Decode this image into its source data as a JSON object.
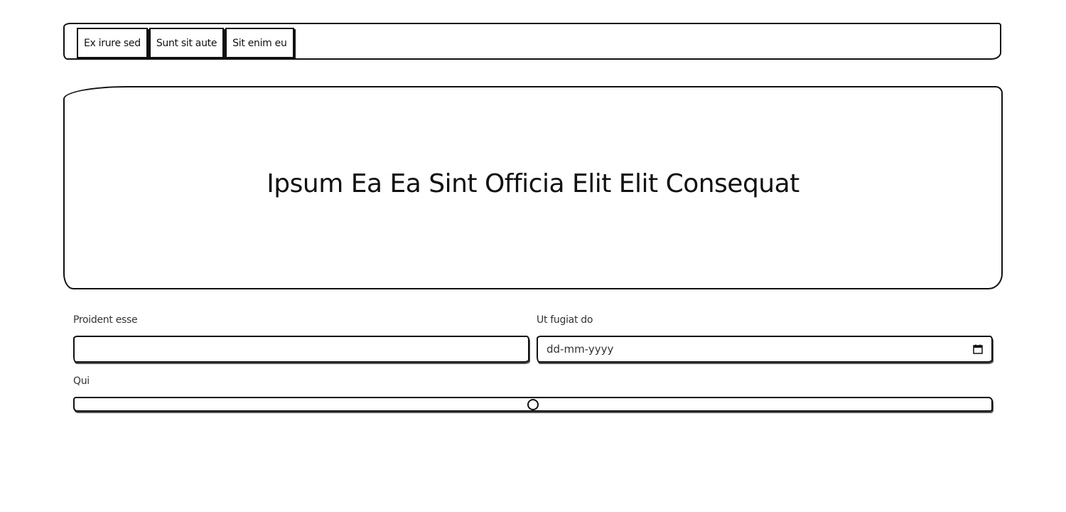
{
  "nav": {
    "tabs": [
      {
        "label": "Ex irure sed"
      },
      {
        "label": "Sunt sit aute"
      },
      {
        "label": "Sit enim eu"
      }
    ]
  },
  "hero": {
    "title": "Ipsum Ea Ea Sint Officia Elit Elit Consequat"
  },
  "form": {
    "text_field": {
      "label": "Proident esse",
      "value": ""
    },
    "date_field": {
      "label": "Ut fugiat do",
      "placeholder": "dd-mm-yyyy",
      "icon": "calendar-icon"
    },
    "range_field": {
      "label": "Qui",
      "value_fraction": 0.5
    }
  }
}
